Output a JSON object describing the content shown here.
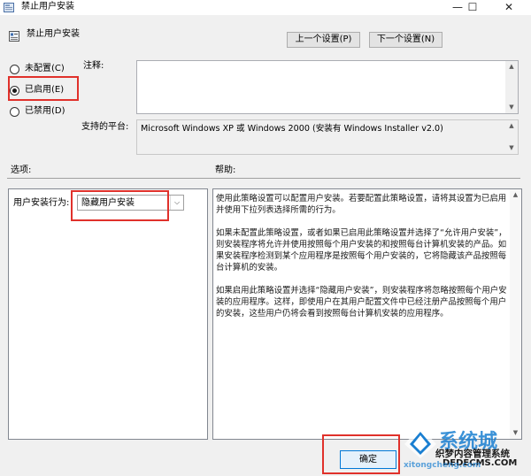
{
  "window": {
    "title": "禁止用户安装",
    "minimize": "—",
    "maximize": "☐",
    "close": "✕"
  },
  "header": {
    "policy_title": "禁止用户安装",
    "prev_button": "上一个设置(P)",
    "next_button": "下一个设置(N)"
  },
  "state": {
    "options": [
      {
        "label": "未配置(C)",
        "checked": false
      },
      {
        "label": "已启用(E)",
        "checked": true
      },
      {
        "label": "已禁用(D)",
        "checked": false
      }
    ]
  },
  "comment": {
    "label": "注释:",
    "value": ""
  },
  "supported": {
    "label": "支持的平台:",
    "value": "Microsoft Windows XP 或 Windows 2000 (安装有 Windows Installer v2.0)"
  },
  "options_pane": {
    "heading": "选项:",
    "field_label": "用户安装行为:",
    "selected": "隐藏用户安装"
  },
  "help_pane": {
    "heading": "帮助:",
    "paragraphs": [
      "使用此策略设置可以配置用户安装。若要配置此策略设置，请将其设置为已启用并使用下拉列表选择所需的行为。",
      "如果未配置此策略设置，或者如果已启用此策略设置并选择了“允许用户安装”，则安装程序将允许并使用按照每个用户安装的和按照每台计算机安装的产品。如果安装程序检测到某个应用程序是按照每个用户安装的，它将隐藏该产品按照每台计算机的安装。",
      "如果启用此策略设置并选择“隐藏用户安装”，则安装程序将忽略按照每个用户安装的应用程序。这样，即使用户在其用户配置文件中已经注册产品按照每个用户的安装，这些用户仍将会看到按照每台计算机安装的应用程序。"
    ]
  },
  "footer": {
    "ok_button": "确定"
  },
  "watermark": {
    "brand": "系统城",
    "line1": "织梦内容管理系统",
    "line2": "DEDECMS.COM",
    "line3": "xitongcheng.com"
  },
  "colors": {
    "highlight": "#e0312b",
    "window_bg": "#f0f0f0",
    "watermark_blue": "#1a7fd1"
  }
}
